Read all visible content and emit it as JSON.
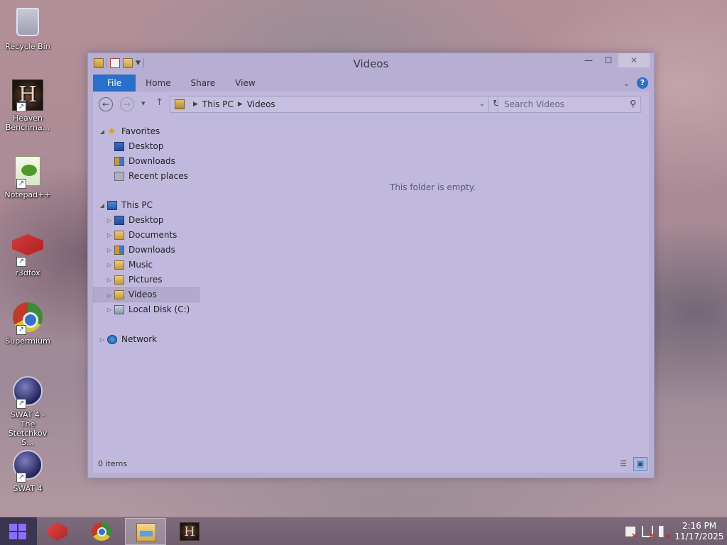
{
  "desktop": {
    "icons": [
      {
        "label": "Recycle Bin",
        "icon": "recycle-bin-icon",
        "shortcut": false
      },
      {
        "label": "Heaven Benchma...",
        "icon": "heaven-benchmark-icon",
        "shortcut": true
      },
      {
        "label": "Notepad++",
        "icon": "notepad-plus-plus-icon",
        "shortcut": true
      },
      {
        "label": "r3dfox",
        "icon": "r3dfox-icon",
        "shortcut": true
      },
      {
        "label": "Supermium",
        "icon": "supermium-icon",
        "shortcut": true
      },
      {
        "label": "SWAT 4 - The Stetchkov S...",
        "icon": "swat4-expansion-icon",
        "shortcut": true
      },
      {
        "label": "SWAT 4",
        "icon": "swat4-icon",
        "shortcut": true
      }
    ]
  },
  "window": {
    "title": "Videos",
    "controls": {
      "minimize": "—",
      "maximize": "☐",
      "close": "✕"
    }
  },
  "ribbon": {
    "tabs": [
      "File",
      "Home",
      "Share",
      "View"
    ],
    "expand": "⌄",
    "help": "?"
  },
  "navigation": {
    "back": "←",
    "forward": "→",
    "recent": "▾",
    "up": "↑",
    "breadcrumb": [
      "This PC",
      "Videos"
    ],
    "refresh": "↻",
    "search_placeholder": "Search Videos"
  },
  "navpane": {
    "favorites": {
      "label": "Favorites",
      "items": [
        "Desktop",
        "Downloads",
        "Recent places"
      ]
    },
    "this_pc": {
      "label": "This PC",
      "items": [
        "Desktop",
        "Documents",
        "Downloads",
        "Music",
        "Pictures",
        "Videos",
        "Local Disk (C:)"
      ],
      "selected": "Videos"
    },
    "network": {
      "label": "Network"
    }
  },
  "main": {
    "empty_message": "This folder is empty."
  },
  "statusbar": {
    "item_count": "0 items"
  },
  "taskbar": {
    "pinned": [
      "r3dfox",
      "Supermium",
      "File Explorer",
      "Heaven Benchmark"
    ],
    "active": "File Explorer",
    "clock_time": "2:16 PM",
    "clock_date": "11/17/2025"
  },
  "colors": {
    "accent": "#2a6fc9",
    "window_bg": "#c1b9dd",
    "taskbar_bg": "#6f5e6e"
  }
}
